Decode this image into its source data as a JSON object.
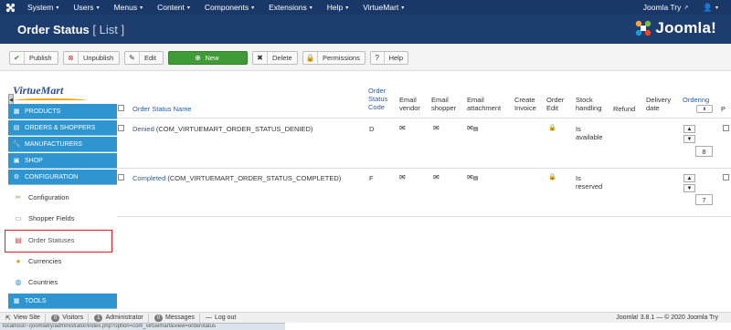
{
  "topnav": {
    "menus": [
      "System",
      "Users",
      "Menus",
      "Content",
      "Components",
      "Extensions",
      "Help",
      "VirtueMart"
    ],
    "user": "Joomla Try",
    "user_icon": "user-icon"
  },
  "titlebar": {
    "title": "Order Status",
    "list_label": "[ List ]",
    "brand": "Joomla!"
  },
  "toolbar": {
    "publish": "Publish",
    "unpublish": "Unpublish",
    "edit": "Edit",
    "new": "New",
    "delete": "Delete",
    "permissions": "Permissions",
    "help": "Help"
  },
  "sidebar": {
    "logo": "VirtueMart",
    "sections": {
      "products": "PRODUCTS",
      "orders": "ORDERS & SHOPPERS",
      "manufacturers": "MANUFACTURERS",
      "shop": "SHOP",
      "configuration": "CONFIGURATION",
      "tools": "TOOLS"
    },
    "items": {
      "configuration": "Configuration",
      "shopper_fields": "Shopper Fields",
      "order_statuses": "Order Statuses",
      "currencies": "Currencies",
      "countries": "Countries"
    }
  },
  "table": {
    "headers": {
      "name": "Order Status Name",
      "code": [
        "Order",
        "Status",
        "Code"
      ],
      "email_vendor": [
        "Email",
        "vendor"
      ],
      "email_shopper": [
        "Email",
        "shopper"
      ],
      "email_attachment": [
        "Email",
        "attachment"
      ],
      "create_invoice": [
        "Create",
        "Invoice"
      ],
      "order_edit": [
        "Order",
        "Edit"
      ],
      "stock_handling": [
        "Stock",
        "handling"
      ],
      "refund": "Refund",
      "delivery_date": [
        "Delivery",
        "date"
      ],
      "ordering": "Ordering",
      "cut": "P"
    },
    "rows": [
      {
        "name": "Denied",
        "constant": "(COM_VIRTUEMART_ORDER_STATUS_DENIED)",
        "code": "D",
        "stock": [
          "Is",
          "available"
        ],
        "ordering": "8"
      },
      {
        "name": "Completed",
        "constant": "(COM_VIRTUEMART_ORDER_STATUS_COMPLETED)",
        "code": "F",
        "stock": [
          "Is",
          "reserved"
        ],
        "ordering": "7"
      }
    ]
  },
  "statusbar": {
    "view_site": "View Site",
    "visitors_count": "0",
    "visitors": "Visitors",
    "admin_count": "1",
    "admin": "Administrator",
    "messages_count": "0",
    "messages": "Messages",
    "logout": "Log out",
    "version": "Joomla! 3.8.1 — © 2020 Joomla Try"
  },
  "url_hint": "localhost/~/joomlatry/administrator/index.php?option=com_virtuemart&view=orderstatus",
  "colors": {
    "topnav": "#1a3867",
    "titlebar": "#1c3d6e",
    "section": "#2e95d1",
    "new_button": "#3e9b36",
    "link": "#2b5c9b",
    "highlight": "#e02020"
  }
}
